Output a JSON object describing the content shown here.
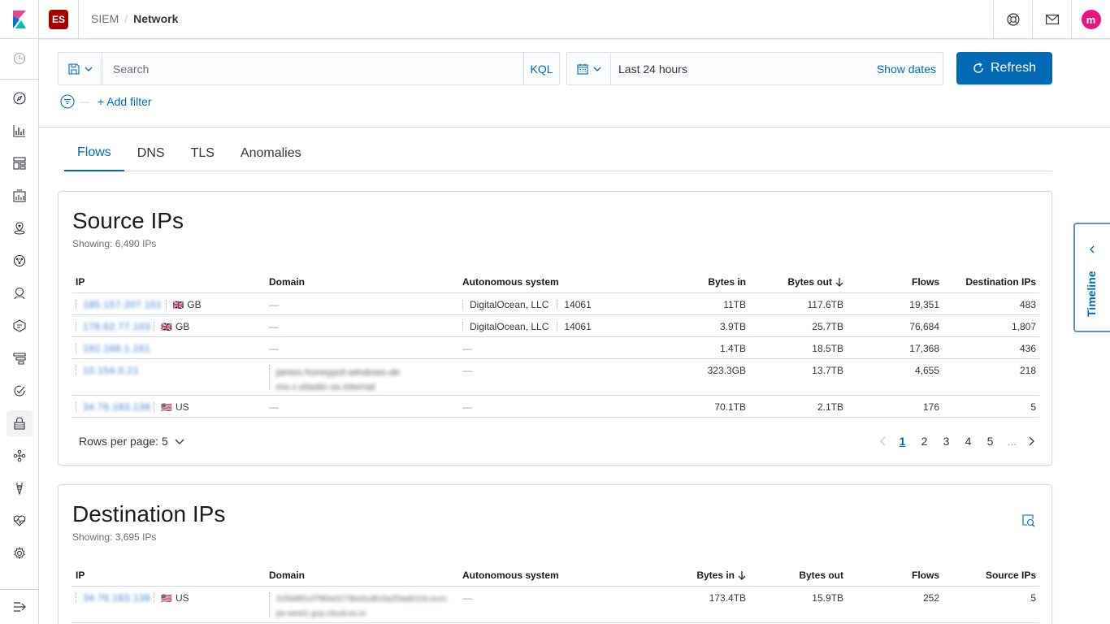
{
  "colors": {
    "accent": "#006bb4",
    "space": "#a50000",
    "avatar": "#e7157e"
  },
  "header": {
    "space_initials": "ES",
    "breadcrumbs": [
      "SIEM",
      "Network"
    ],
    "avatar_initial": "m",
    "icons": [
      "help-icon",
      "mail-icon"
    ]
  },
  "sidenav": {
    "items": [
      "recently-viewed-icon",
      "discover-icon",
      "visualize-icon",
      "dashboard-icon",
      "canvas-icon",
      "maps-icon",
      "ml-icon",
      "infrastructure-icon",
      "logs-icon",
      "apm-icon",
      "uptime-icon",
      "siem-icon",
      "graph-icon",
      "dev-tools-icon",
      "monitoring-icon",
      "management-icon",
      "collapse-icon"
    ]
  },
  "query": {
    "search_placeholder": "Search",
    "language": "KQL",
    "date_range": "Last 24 hours",
    "show_dates": "Show dates",
    "refresh": "Refresh",
    "add_filter": "+ Add filter"
  },
  "tabs": [
    {
      "label": "Flows",
      "selected": true
    },
    {
      "label": "DNS",
      "selected": false
    },
    {
      "label": "TLS",
      "selected": false
    },
    {
      "label": "Anomalies",
      "selected": false
    }
  ],
  "source_ips": {
    "title": "Source IPs",
    "subtitle": "Showing: 6,490 IPs",
    "columns": [
      "IP",
      "Domain",
      "Autonomous system",
      "Bytes in",
      "Bytes out",
      "Flows",
      "Destination IPs"
    ],
    "sorted_column": "Bytes out",
    "rows": [
      {
        "ip": "185.157.207.151",
        "country": "GB",
        "flag": "🇬🇧",
        "domain": "—",
        "as_name": "DigitalOcean, LLC",
        "as_num": "14061",
        "bytes_in": "11TB",
        "bytes_out": "117.6TB",
        "flows": "19,351",
        "dest_ips": "483"
      },
      {
        "ip": "178.62.77.103",
        "country": "GB",
        "flag": "🇬🇧",
        "domain": "—",
        "as_name": "DigitalOcean, LLC",
        "as_num": "14061",
        "bytes_in": "3.9TB",
        "bytes_out": "25.7TB",
        "flows": "76,684",
        "dest_ips": "1,807"
      },
      {
        "ip": "192.168.1.161",
        "country": "",
        "flag": "",
        "domain": "—",
        "as_name": "—",
        "as_num": "",
        "bytes_in": "1.4TB",
        "bytes_out": "18.5TB",
        "flows": "17,368",
        "dest_ips": "436"
      },
      {
        "ip": "10.154.0.21",
        "country": "",
        "flag": "",
        "domain": "james-honeypot-windows-demo.c.elastic-ss.internal",
        "as_name": "—",
        "as_num": "",
        "bytes_in": "323.3GB",
        "bytes_out": "13.7TB",
        "flows": "4,655",
        "dest_ips": "218"
      },
      {
        "ip": "34.76.183.138",
        "country": "US",
        "flag": "🇺🇸",
        "domain": "—",
        "as_name": "—",
        "as_num": "",
        "bytes_in": "70.1TB",
        "bytes_out": "2.1TB",
        "flows": "176",
        "dest_ips": "5"
      }
    ],
    "rows_per_page": "Rows per page: 5",
    "pages": [
      "1",
      "2",
      "3",
      "4",
      "5",
      "..."
    ],
    "current_page": "1"
  },
  "destination_ips": {
    "title": "Destination IPs",
    "subtitle": "Showing: 3,695 IPs",
    "columns": [
      "IP",
      "Domain",
      "Autonomous system",
      "Bytes in",
      "Bytes out",
      "Flows",
      "Source IPs"
    ],
    "sorted_column": "Bytes in",
    "rows": [
      {
        "ip": "34.76.183.138",
        "country": "US",
        "flag": "🇺🇸",
        "domain": "31f0d8f1cf7f80e0273be5cd51fa2f3ad011b.europe-west1.gcp.cloud.es.io",
        "as_name": "—",
        "bytes_in": "173.4TB",
        "bytes_out": "15.9TB",
        "flows": "252",
        "source_ips": "5"
      }
    ]
  },
  "timeline": {
    "label": "Timeline"
  }
}
